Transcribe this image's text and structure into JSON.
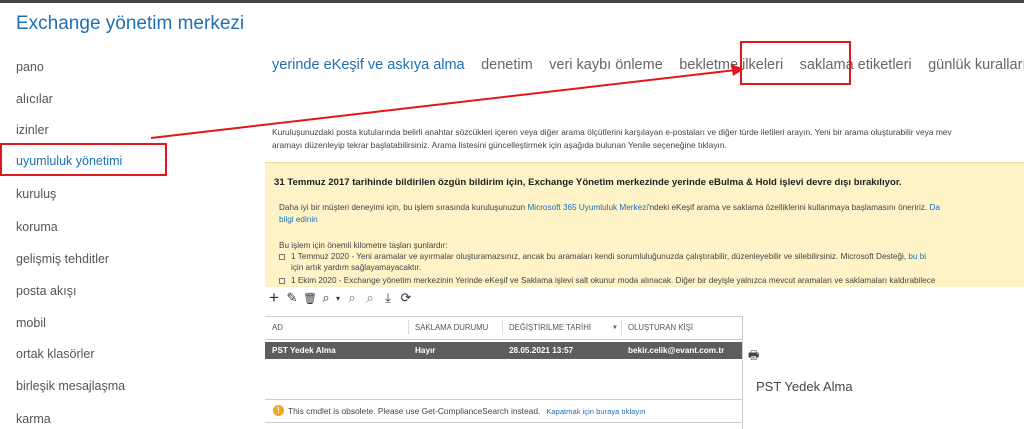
{
  "app": {
    "title": "Exchange yönetim merkezi"
  },
  "sidebar": {
    "items": [
      {
        "label": "pano"
      },
      {
        "label": "alıcılar"
      },
      {
        "label": "izinler"
      },
      {
        "label": "uyumluluk yönetimi"
      },
      {
        "label": "kuruluş"
      },
      {
        "label": "koruma"
      },
      {
        "label": "gelişmiş tehditler"
      },
      {
        "label": "posta akışı"
      },
      {
        "label": "mobil"
      },
      {
        "label": "ortak klasörler"
      },
      {
        "label": "birleşik mesajlaşma"
      },
      {
        "label": "karma"
      }
    ]
  },
  "tabs": [
    {
      "label": "yerinde eKeşif ve askıya alma"
    },
    {
      "label": "denetim"
    },
    {
      "label": "veri kaybı önleme"
    },
    {
      "label": "bekletme ilkeleri"
    },
    {
      "label": "saklama etiketleri"
    },
    {
      "label": "günlük kuralları"
    }
  ],
  "description": {
    "line1": "Kuruluşunuzdaki posta kutularında belirli anahtar sözcükleri içeren veya diğer arama ölçütlerini karşılayan e-postaları ve diğer türde iletileri arayın. Yeni bir arama oluşturabilir veya mev",
    "line2": "aramayı düzenleyip tekrar başlatabilirsiniz. Arama listesini güncelleştirmek için aşağıda bulunan Yenile seçeneğine tıklayın."
  },
  "notice": {
    "title": "31 Temmuz 2017 tarihinde bildirilen özgün bildirim için, Exchange Yönetim merkezinde yerinde eBulma & Hold işlevi devre dışı bırakılıyor.",
    "p1_pre": "Daha iyi bir müşteri deneyimi için, bu işlem sırasında kuruluşunuzun ",
    "p1_link": "Microsoft 365 Uyumluluk Merkezi",
    "p1_post": "'ndeki eKeşif arama ve saklama özelliklerini kullanmaya başlamasını öneririz. ",
    "p1_link2": "Da",
    "p1_line2": "bilgi edinin",
    "milestones_intro": "Bu işlem için önemli kilometre taşları şunlardır:",
    "b1_line1": "1 Temmuz 2020 - Yeni aramalar ve ayırmalar oluşturamazsınız, ancak bu aramaları kendi sorumluluğunuzda çalıştırabilir, düzenleyebilir ve silebilirsiniz. Microsoft Desteği, ",
    "b1_link": "bu bi",
    "b1_line2": "için artık yardım sağlayamayacaktır.",
    "b2": "1 Ekim 2020 - Exchange yönetim merkezinin Yerinde eKeşif ve Saklama işlevi salt okunur moda alınacak. Diğer bir deyişle yalnızca mevcut aramaları ve saklamaları kaldırabilece"
  },
  "toolbar": {
    "add": "+",
    "edit": "✎",
    "delete": "🗑",
    "search": "⌕",
    "search_caret": "▾",
    "start": "⌕",
    "stop": "⌕",
    "export": "⤓",
    "refresh": "⟳"
  },
  "grid": {
    "columns": [
      "AD",
      "SAKLAMA DURUMU",
      "DEĞİŞTİRİLME TARİHİ",
      "OLUŞTURAN KİŞİ"
    ],
    "sort_indicator": "▼",
    "rows": [
      {
        "name": "PST Yedek Alma",
        "hold": "Hayır",
        "modified": "28.05.2021 13:57",
        "creator": "bekir.celik@evant.com.tr"
      }
    ]
  },
  "footer": {
    "warning_icon": "!",
    "message": "This cmdlet is obsolete. Please use Get-ComplianceSearch instead.",
    "link": "Kapatmak için buraya tıklayın"
  },
  "detail": {
    "print_icon": "🖶",
    "title": "PST Yedek Alma"
  },
  "colors": {
    "accent": "#1e6fb5",
    "highlight": "#e0181b",
    "notice_bg": "#fdf3c7",
    "row_selected": "#5d5d5d"
  }
}
